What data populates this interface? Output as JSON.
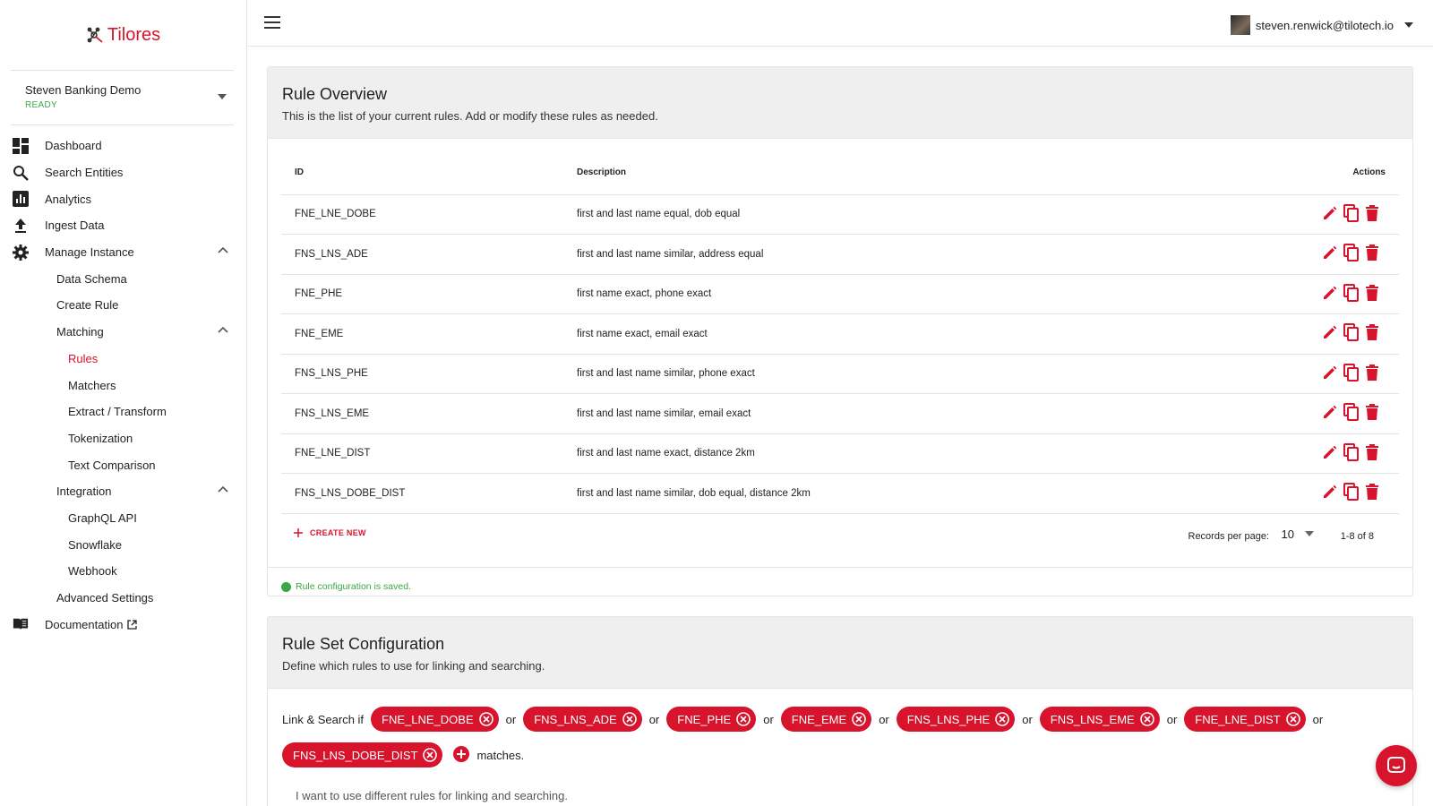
{
  "brand": {
    "name": "Tilores",
    "accent": "#d7142c",
    "success": "#3aa845"
  },
  "instance": {
    "name": "Steven Banking Demo",
    "status": "READY"
  },
  "sidebar": {
    "items": [
      {
        "label": "Dashboard",
        "icon": "dashboard-icon"
      },
      {
        "label": "Search Entities",
        "icon": "search-icon"
      },
      {
        "label": "Analytics",
        "icon": "analytics-icon"
      },
      {
        "label": "Ingest Data",
        "icon": "upload-icon"
      },
      {
        "label": "Manage Instance",
        "icon": "gear-icon"
      },
      {
        "label": "Data Schema"
      },
      {
        "label": "Create Rule"
      },
      {
        "label": "Matching"
      },
      {
        "label": "Rules"
      },
      {
        "label": "Matchers"
      },
      {
        "label": "Extract / Transform"
      },
      {
        "label": "Tokenization"
      },
      {
        "label": "Text Comparison"
      },
      {
        "label": "Integration"
      },
      {
        "label": "GraphQL API"
      },
      {
        "label": "Snowflake"
      },
      {
        "label": "Webhook"
      },
      {
        "label": "Advanced Settings"
      },
      {
        "label": "Documentation",
        "icon": "book-icon"
      }
    ]
  },
  "header": {
    "user_email": "steven.renwick@tilotech.io"
  },
  "rules_overview": {
    "title": "Rule Overview",
    "subtitle": "This is the list of your current rules. Add or modify these rules as needed.",
    "columns": {
      "id": "ID",
      "description": "Description",
      "actions": "Actions"
    },
    "rows": [
      {
        "id": "FNE_LNE_DOBE",
        "description": "first and last name equal, dob equal"
      },
      {
        "id": "FNS_LNS_ADE",
        "description": "first and last name similar, address equal"
      },
      {
        "id": "FNE_PHE",
        "description": "first name exact, phone exact"
      },
      {
        "id": "FNE_EME",
        "description": "first name exact, email exact"
      },
      {
        "id": "FNS_LNS_PHE",
        "description": "first and last name similar, phone exact"
      },
      {
        "id": "FNS_LNS_EME",
        "description": "first and last name similar, email exact"
      },
      {
        "id": "FNE_LNE_DIST",
        "description": "first and last name exact, distance 2km"
      },
      {
        "id": "FNS_LNS_DOBE_DIST",
        "description": "first and last name similar, dob equal, distance 2km"
      }
    ],
    "create_new": "CREATE NEW",
    "records_per_page_label": "Records per page:",
    "records_per_page": "10",
    "pagination": "1-8 of 8",
    "saved_message": "Rule configuration is saved."
  },
  "rule_set": {
    "title": "Rule Set Configuration",
    "subtitle": "Define which rules to use for linking and searching.",
    "prefix": "Link & Search if",
    "joiner": "or",
    "suffix": "matches.",
    "chips": [
      "FNE_LNE_DOBE",
      "FNS_LNS_ADE",
      "FNE_PHE",
      "FNE_EME",
      "FNS_LNS_PHE",
      "FNS_LNS_EME",
      "FNE_LNE_DIST",
      "FNS_LNS_DOBE_DIST"
    ],
    "different_rules": "I want to use different rules for linking and searching."
  }
}
